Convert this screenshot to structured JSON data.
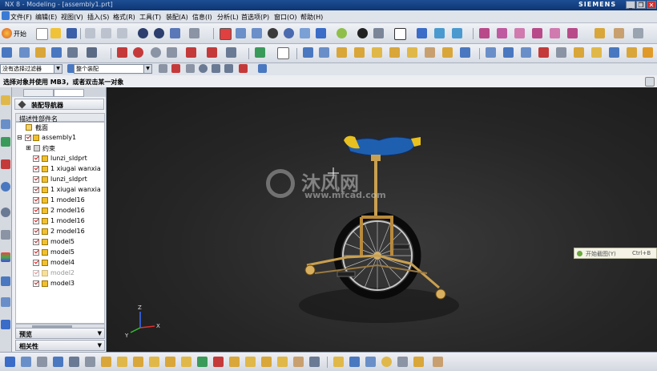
{
  "window": {
    "title": "NX 8 - Modeling - [assembly1.prt]",
    "brand": "SIEMENS",
    "controls": [
      "_",
      "❐",
      "✕"
    ]
  },
  "menu": [
    "文件(F)",
    "编辑(E)",
    "视图(V)",
    "插入(S)",
    "格式(R)",
    "工具(T)",
    "装配(A)",
    "信息(I)",
    "分析(L)",
    "首选项(P)",
    "窗口(O)",
    "帮助(H)"
  ],
  "toolbar": {
    "start_label": "开始"
  },
  "filter": {
    "selection_filter": "没有选择过滤器",
    "assembly_scope": "整个装配"
  },
  "status": {
    "prompt": "选择对象并使用 MB3，或者双击某一对象"
  },
  "navigator": {
    "title": "装配导航器",
    "column_header": "描述性部件名",
    "items": [
      {
        "label": "截面",
        "type": "folder",
        "checked": false
      },
      {
        "label": "assembly1",
        "type": "assembly",
        "checked": true
      },
      {
        "label": "约束",
        "type": "constraints",
        "checked": false
      },
      {
        "label": "lunzi_sldprt",
        "type": "part",
        "checked": true
      },
      {
        "label": "1 xiugai wanxia",
        "type": "part",
        "checked": true
      },
      {
        "label": "lunzi_sldprt",
        "type": "part",
        "checked": true
      },
      {
        "label": "1 xiugai wanxia",
        "type": "part",
        "checked": true
      },
      {
        "label": "1 model16",
        "type": "part",
        "checked": true
      },
      {
        "label": "2 model16",
        "type": "part",
        "checked": true
      },
      {
        "label": "1 model16",
        "type": "part",
        "checked": true
      },
      {
        "label": "2 model16",
        "type": "part",
        "checked": true
      },
      {
        "label": "model5",
        "type": "part",
        "checked": true
      },
      {
        "label": "model5",
        "type": "part",
        "checked": true
      },
      {
        "label": "model4",
        "type": "part",
        "checked": true
      },
      {
        "label": "model2",
        "type": "part",
        "checked": true,
        "dim": true
      },
      {
        "label": "model3",
        "type": "part",
        "checked": true
      }
    ],
    "panels": [
      "预览",
      "相关性"
    ]
  },
  "viewport": {
    "tooltip_text": "开始截图(Y)",
    "tooltip_shortcut": "Ctrl+B",
    "watermark_text": "沐风网",
    "watermark_url": "www.mfcad.com",
    "axis_labels": [
      "X",
      "Y",
      "Z"
    ]
  },
  "colors": {
    "seat_blue": "#1f5fb0",
    "seat_yellow": "#e8c020",
    "frame_gold": "#b98a3c"
  }
}
